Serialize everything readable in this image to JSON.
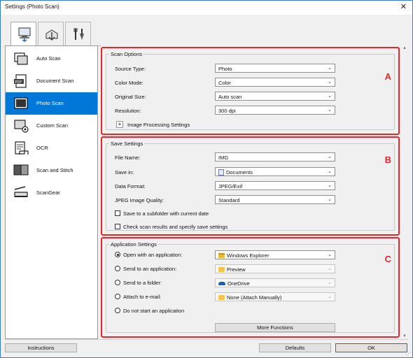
{
  "window": {
    "title": "Settings (Photo Scan)",
    "close_glyph": "✕"
  },
  "tabs": [
    {
      "icon": "computer-scan-icon",
      "active": true
    },
    {
      "icon": "scan-to-pc-icon",
      "active": false
    },
    {
      "icon": "tools-icon",
      "active": false
    }
  ],
  "sidebar": {
    "items": [
      {
        "label": "Auto Scan",
        "active": false
      },
      {
        "label": "Document Scan",
        "active": false
      },
      {
        "label": "Photo Scan",
        "active": true
      },
      {
        "label": "Custom Scan",
        "active": false
      },
      {
        "label": "OCR",
        "active": false
      },
      {
        "label": "Scan and Stitch",
        "active": false
      },
      {
        "label": "ScanGear",
        "active": false
      }
    ],
    "pdf_badge": "PDF"
  },
  "scan_options": {
    "title": "Scan Options",
    "letter": "A",
    "rows": [
      {
        "label": "Source Type:",
        "value": "Photo"
      },
      {
        "label": "Color Mode:",
        "value": "Color"
      },
      {
        "label": "Original Size:",
        "value": "Auto scan"
      },
      {
        "label": "Resolution:",
        "value": "300 dpi"
      }
    ],
    "expander_glyph": "+",
    "image_processing_label": "Image Processing Settings"
  },
  "save_settings": {
    "title": "Save Settings",
    "letter": "B",
    "file_name_label": "File Name:",
    "file_name_value": "IMG",
    "save_in_label": "Save in:",
    "save_in_value": "Documents",
    "data_format_label": "Data Format:",
    "data_format_value": "JPEG/Exif",
    "jpeg_quality_label": "JPEG Image Quality:",
    "jpeg_quality_value": "Standard",
    "checkbox_subfolder": "Save to a subfolder with current date",
    "checkbox_check_results": "Check scan results and specify save settings"
  },
  "application_settings": {
    "title": "Application Settings",
    "letter": "C",
    "open_with_label": "Open with an application:",
    "open_with_value": "Windows Explorer",
    "send_app_label": "Send to an application:",
    "send_app_value": "Preview",
    "send_folder_label": "Send to a folder:",
    "send_folder_value": "OneDrive",
    "attach_email_label": "Attach to e-mail:",
    "attach_email_value": "None (Attach Manually)",
    "no_app_label": "Do not start an application",
    "more_functions_label": "More Functions",
    "selected_option": "Open with an application:"
  },
  "footer": {
    "instructions_label": "Instructions",
    "defaults_label": "Defaults",
    "ok_label": "OK"
  },
  "colors": {
    "accent": "#0078d7",
    "highlight_red": "#e8262b"
  },
  "glyphs": {
    "caret": "⌄",
    "scroll_up": "▲",
    "scroll_down": "▼",
    "resize": "⋰"
  }
}
